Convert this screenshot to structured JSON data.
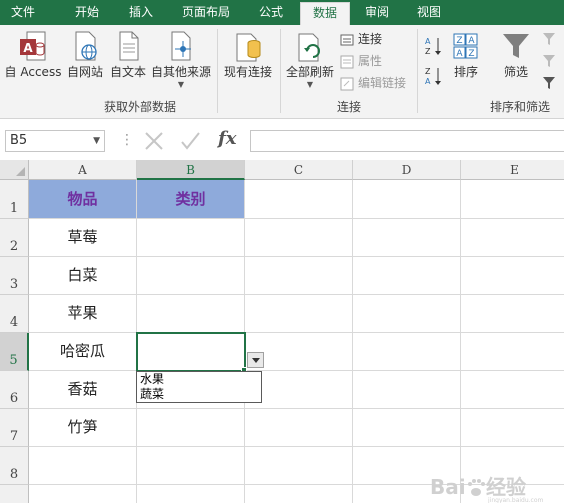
{
  "ribbon_tabs": [
    {
      "label": "文件",
      "active": false
    },
    {
      "label": "开始",
      "active": false
    },
    {
      "label": "插入",
      "active": false
    },
    {
      "label": "页面布局",
      "active": false
    },
    {
      "label": "公式",
      "active": false
    },
    {
      "label": "数据",
      "active": true
    },
    {
      "label": "审阅",
      "active": false
    },
    {
      "label": "视图",
      "active": false
    }
  ],
  "ribbon": {
    "external_data": {
      "group_label": "获取外部数据",
      "buttons": [
        "自 Access",
        "自网站",
        "自文本",
        "自其他来源",
        "现有连接"
      ]
    },
    "connections": {
      "group_label": "连接",
      "refresh_all": "全部刷新",
      "connections": "连接",
      "properties": "属性",
      "edit_links": "编辑链接"
    },
    "sort_filter": {
      "group_label": "排序和筛选",
      "sort": "排序",
      "filter": "筛选"
    }
  },
  "formula_bar": {
    "name_box": "B5",
    "fx": "fx",
    "content": ""
  },
  "sheet": {
    "columns": [
      "A",
      "B",
      "C",
      "D",
      "E"
    ],
    "rows": [
      "1",
      "2",
      "3",
      "4",
      "5",
      "6",
      "7",
      "8"
    ],
    "selected_cell": "B5",
    "cells": {
      "A1": "物品",
      "B1": "类别",
      "A2": "草莓",
      "A3": "白菜",
      "A4": "苹果",
      "A5": "哈密瓜",
      "A6": "香菇",
      "A7": "竹笋"
    },
    "validation_list": [
      "水果",
      "蔬菜"
    ]
  },
  "colors": {
    "excel_green": "#217346",
    "header_fill": "#8eaadb",
    "header_text": "#7030a0"
  }
}
